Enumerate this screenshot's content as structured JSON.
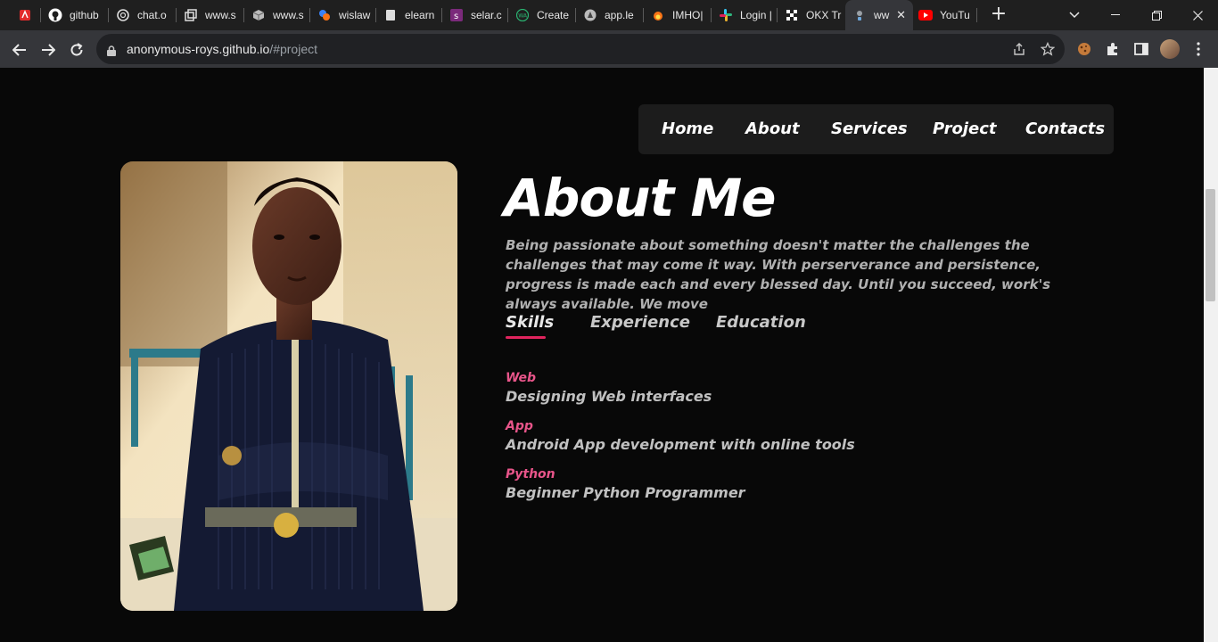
{
  "browser": {
    "tabs": [
      {
        "title": "",
        "favicon": "pdf-icon"
      },
      {
        "title": "github",
        "favicon": "github-icon"
      },
      {
        "title": "chat.o",
        "favicon": "openai-icon"
      },
      {
        "title": "www.s",
        "favicon": "window-icon"
      },
      {
        "title": "www.s",
        "favicon": "cube-icon"
      },
      {
        "title": "wislaw",
        "favicon": "colorful-icon"
      },
      {
        "title": "elearn",
        "favicon": "page-icon"
      },
      {
        "title": "selar.c",
        "favicon": "selar-icon"
      },
      {
        "title": "Create",
        "favicon": "wa-icon"
      },
      {
        "title": "app.le",
        "favicon": "shield-icon"
      },
      {
        "title": "IMHO|",
        "favicon": "fire-icon"
      },
      {
        "title": "Login |",
        "favicon": "slack-icon"
      },
      {
        "title": "OKX Tr",
        "favicon": "okx-icon"
      },
      {
        "title": "ww",
        "favicon": "globe-icon"
      },
      {
        "title": "YouTu",
        "favicon": "youtube-icon"
      }
    ],
    "url_host": "anonymous-roys.github.io",
    "url_path": "/#project"
  },
  "nav": {
    "items": [
      "Home",
      "About",
      "Services",
      "Project",
      "Contacts"
    ]
  },
  "about": {
    "title": "About Me",
    "intro": "Being passionate about something doesn't matter the challenges the challenges that may come it way. With perserverance and persistence, progress is made each and every blessed day. Until you succeed, work's always available. We move",
    "tabs": [
      "Skills",
      "Experience",
      "Education"
    ],
    "skills": [
      {
        "name": "Web",
        "desc": "Designing Web interfaces"
      },
      {
        "name": "App",
        "desc": "Android App development with online tools"
      },
      {
        "name": "Python",
        "desc": "Beginner Python Programmer"
      }
    ]
  },
  "colors": {
    "accent": "#e0245e",
    "skill_label": "#e8558a",
    "background": "#080808"
  }
}
